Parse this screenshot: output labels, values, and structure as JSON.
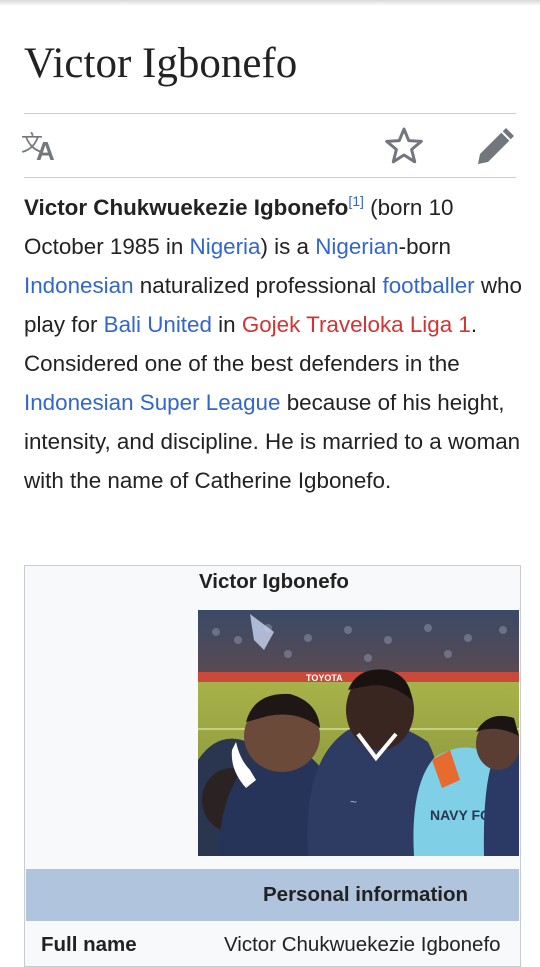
{
  "article": {
    "title": "Victor Igbonefo"
  },
  "actions": {
    "language_icon": "language-icon",
    "watch_icon": "star-icon",
    "edit_icon": "pencil-icon"
  },
  "intro": {
    "full_name": "Victor Chukwuekezie Igbonefo",
    "ref": "[1]",
    "t1": " (born 10 October 1985 in ",
    "link_nigeria": "Nigeria",
    "t2": ") is a ",
    "link_nigerian": "Nigerian",
    "t3": "-born ",
    "link_indonesian": "Indonesian",
    "t4": " naturalized professional ",
    "link_footballer": "footballer",
    "t5": " who play for ",
    "link_bali": "Bali United",
    "t6": " in ",
    "link_gojek": "Gojek Traveloka Liga 1",
    "t7": ". Considered one of the best defenders in the ",
    "link_isl": "Indonesian Super League",
    "t8": " because of his height, intensity, and discipline. He is married to a woman with the name of Catherine Igbonefo."
  },
  "infobox": {
    "caption": "Victor Igbonefo",
    "photo_vest_text": "NAVY FC",
    "photo_banner_text": "TOYOTA",
    "section_header": "Personal information",
    "rows": [
      {
        "label": "Full name",
        "value": "Victor Chukwuekezie Igbonefo"
      }
    ]
  },
  "colors": {
    "link": "#3366cc",
    "redlink": "#d33333",
    "text": "#222222",
    "infobox_header_bg": "#b0c4de"
  }
}
